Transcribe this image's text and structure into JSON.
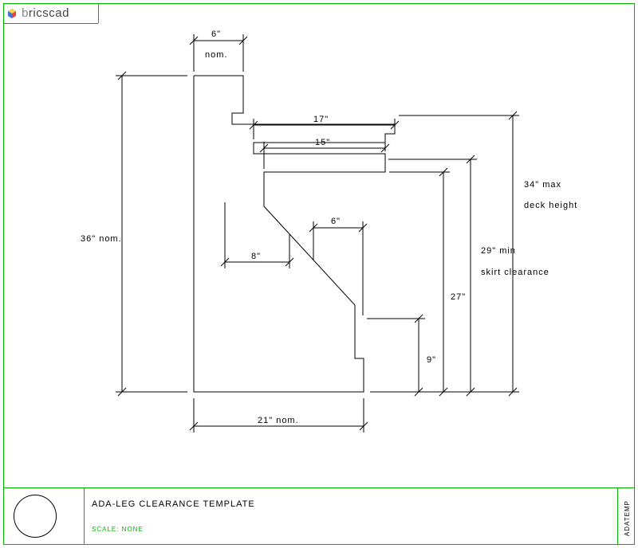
{
  "logo": {
    "text": "bricscad"
  },
  "titleBlock": {
    "title": "ADA-LEG CLEARANCE TEMPLATE",
    "scale": "SCALE: NONE",
    "sideRef": "ADATEMP"
  },
  "dims": {
    "top6": {
      "label": "6\"",
      "sub": "nom."
    },
    "h36": {
      "label": "36\" nom."
    },
    "d17": {
      "label": "17\""
    },
    "d15": {
      "label": "15\""
    },
    "d8": {
      "label": "8\""
    },
    "d6": {
      "label": "6\""
    },
    "h34": {
      "label": "34\" max",
      "sub": "deck height"
    },
    "h29": {
      "label": "29\" min",
      "sub": "skirt clearance"
    },
    "h27": {
      "label": "27\""
    },
    "h9": {
      "label": "9\""
    },
    "w21": {
      "label": "21\" nom."
    }
  }
}
